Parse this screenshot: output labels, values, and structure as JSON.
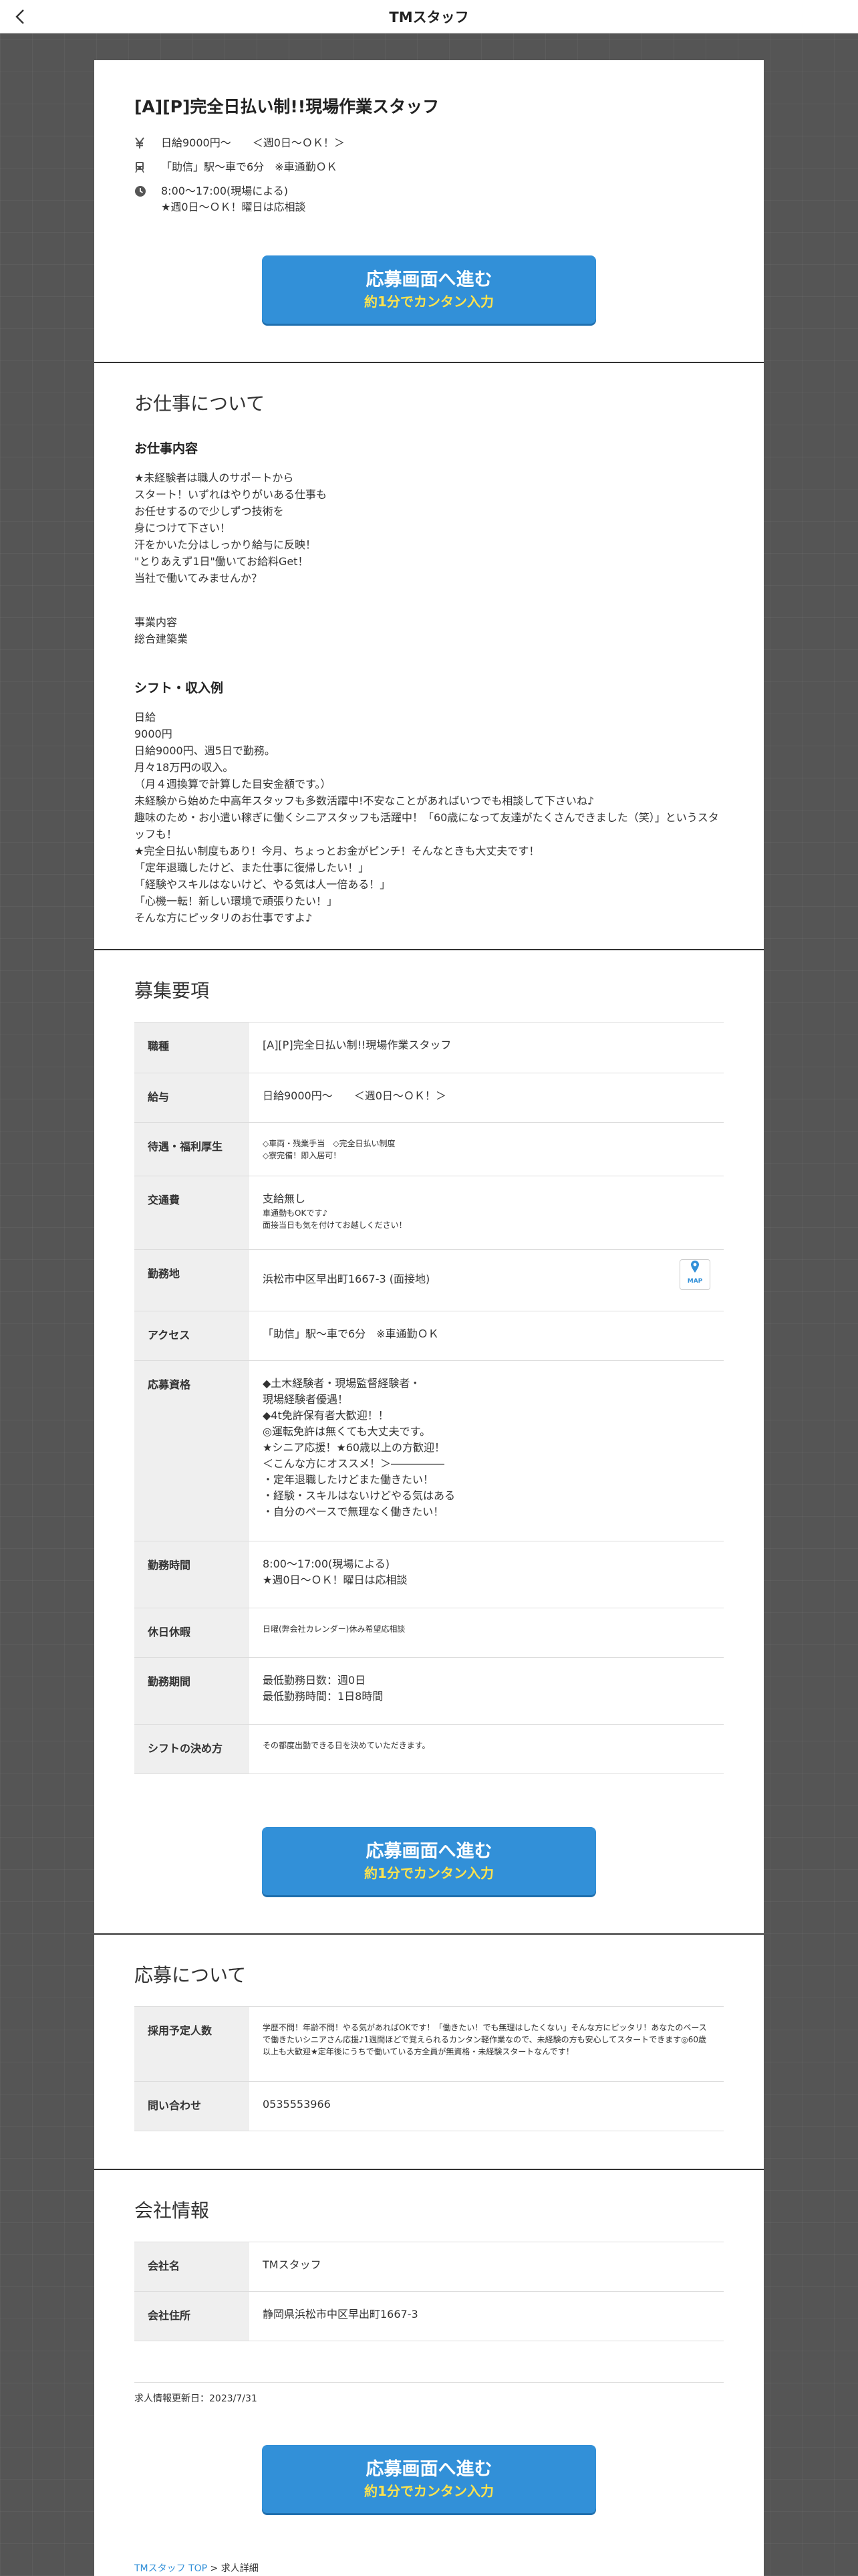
{
  "header": {
    "title": "TMスタッフ"
  },
  "job": {
    "title": "[A][P]完全日払い制!!現場作業スタッフ",
    "salary": "日給9000円～　　＜週0日～ＯＫ！＞",
    "access": "「助信」駅～車で6分　※車通勤ＯＫ",
    "hours_1": "8:00～17:00(現場による)",
    "hours_2": "★週0日～ＯＫ！曜日は応相談"
  },
  "apply_button": {
    "main": "応募画面へ進む",
    "sub": "約1分でカンタン入力"
  },
  "about": {
    "heading": "お仕事について",
    "content_heading": "お仕事内容",
    "content_lines": [
      "★未経験者は職人のサポートから",
      "スタート！いずれはやりがいある仕事も",
      "お任せするので少しずつ技術を",
      "身につけて下さい！",
      "汗をかいた分はしっかり給与に反映！",
      "\"とりあえず1日\"働いてお給料Get！",
      "当社で働いてみませんか？"
    ],
    "business_lines": [
      "事業内容",
      "総合建築業"
    ],
    "shift_heading": "シフト・収入例",
    "shift_lines": [
      "日給",
      "9000円",
      "日給9000円、週5日で勤務。",
      "月々18万円の収入。",
      "（月４週換算で計算した目安金額です。）",
      "未経験から始めた中高年スタッフも多数活躍中!不安なことがあればいつでも相談して下さいね♪",
      "趣味のため・お小遣い稼ぎに働くシニアスタッフも活躍中！「60歳になって友達がたくさんできました（笑）」というスタッフも！",
      "★完全日払い制度もあり！今月、ちょっとお金がピンチ！そんなときも大丈夫です！",
      "「定年退職したけど、また仕事に復帰したい！」",
      "「経験やスキルはないけど、やる気は人一倍ある！」",
      "「心機一転！新しい環境で頑張りたい！」",
      "そんな方にピッタリのお仕事ですよ♪"
    ]
  },
  "requirements": {
    "heading": "募集要項",
    "rows": {
      "job_type": {
        "label": "職種",
        "value": "[A][P]完全日払い制!!現場作業スタッフ"
      },
      "pay": {
        "label": "給与",
        "value": "日給9000円～　　＜週0日～ＯＫ！＞"
      },
      "benefits": {
        "label": "待遇・福利厚生",
        "lines": [
          "◇車両・残業手当　◇完全日払い制度",
          "◇寮完備！即入居可！"
        ]
      },
      "transport": {
        "label": "交通費",
        "main": "支給無し",
        "lines": [
          "車通勤もOKです♪",
          "面接当日も気を付けてお越しください！"
        ]
      },
      "location": {
        "label": "勤務地",
        "value": "浜松市中区早出町1667-3 (面接地)",
        "map": "MAP"
      },
      "access": {
        "label": "アクセス",
        "value": "「助信」駅～車で6分　※車通勤ＯＫ"
      },
      "qualification": {
        "label": "応募資格",
        "lines": [
          "◆土木経験者・現場監督経験者・",
          "現場経験者優遇！",
          "◆4t免許保有者大歓迎！！",
          "◎運転免許は無くても大丈夫です。",
          "★シニア応援！★60歳以上の方歓迎！",
          "＜こんな方にオススメ！＞―――――",
          "・定年退職したけどまた働きたい！",
          "・経験・スキルはないけどやる気はある",
          "・自分のペースで無理なく働きたい！"
        ]
      },
      "work_hours": {
        "label": "勤務時間",
        "lines": [
          "8:00～17:00(現場による)",
          "★週0日～ＯＫ！曜日は応相談"
        ]
      },
      "holidays": {
        "label": "休日休暇",
        "value": "日曜(弊会社カレンダー)休み希望応相談"
      },
      "period": {
        "label": "勤務期間",
        "lines": [
          "最低勤務日数：週0日",
          "最低勤務時間：1日8時間"
        ]
      },
      "shift_rule": {
        "label": "シフトの決め方",
        "value": "その都度出勤できる日を決めていただきます。"
      }
    }
  },
  "application": {
    "heading": "応募について",
    "rows": {
      "hires": {
        "label": "採用予定人数",
        "value": "学歴不問！年齢不問！やる気があればOKです！「働きたい！でも無理はしたくない」そんな方にピッタリ！あなたのペースで働きたいシニアさん応援♪1週間ほどで覚えられるカンタン軽作業なので、未経験の方も安心してスタートできます◎60歳以上も大歓迎★定年後にうちで働いている方全員が無資格・未経験スタートなんです！"
      },
      "contact": {
        "label": "問い合わせ",
        "value": "0535553966"
      }
    }
  },
  "company": {
    "heading": "会社情報",
    "rows": {
      "name": {
        "label": "会社名",
        "value": "TMスタッフ"
      },
      "address": {
        "label": "会社住所",
        "value": "静岡県浜松市中区早出町1667-3"
      }
    },
    "updated": "求人情報更新日：2023/7/31"
  },
  "breadcrumb": {
    "top": "TMスタッフ TOP",
    "separator": " > ",
    "current": "求人詳細"
  }
}
